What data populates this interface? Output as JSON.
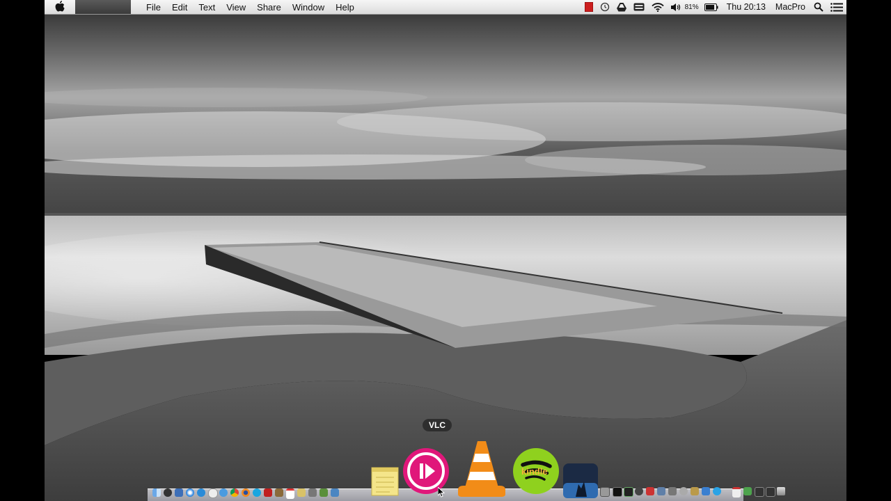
{
  "menubar": {
    "menus": [
      "File",
      "Edit",
      "Text",
      "View",
      "Share",
      "Window",
      "Help"
    ],
    "battery_percent": "81%",
    "clock": "Thu 20:13",
    "user": "MacPro",
    "status_icons": [
      "red-square-icon",
      "timemachine-icon",
      "drive-icon",
      "keyboard-icon",
      "wifi-icon",
      "volume-icon",
      "battery-icon",
      "search-icon",
      "list-icon"
    ]
  },
  "dock": {
    "tooltip": "VLC",
    "kindle_label": "kindle",
    "big_icons": [
      "stickies-icon",
      "itunes-icon",
      "vlc-icon",
      "spotify-icon",
      "kindle-icon"
    ]
  }
}
